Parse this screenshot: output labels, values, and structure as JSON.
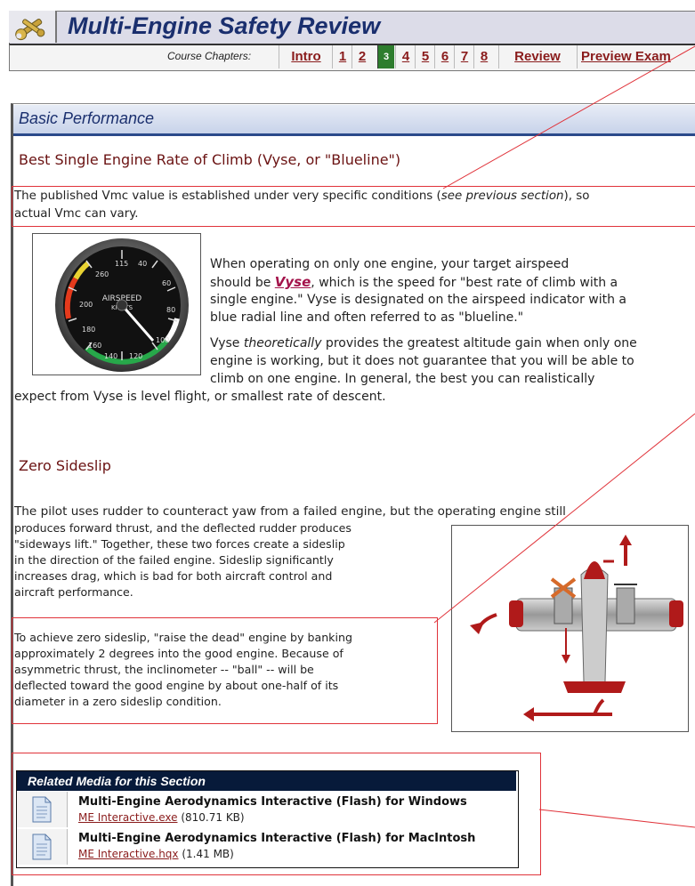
{
  "header": {
    "title": "Multi-Engine Safety Review",
    "nav_label": "Course Chapters:",
    "chapters": [
      "Intro",
      "1",
      "2",
      "3",
      "4",
      "5",
      "6",
      "7",
      "8",
      "Review",
      "Preview Exam"
    ],
    "active_chapter": "3"
  },
  "section": {
    "title": "Basic Performance"
  },
  "vyse": {
    "heading": "Best Single Engine Rate of Climb (Vyse, or \"Blueline\")",
    "intro_a": "The published Vmc value is established under very specific conditions (",
    "intro_see": "see previous section",
    "intro_b": "), so",
    "intro_c": "actual Vmc can vary.",
    "p1_l1": "When operating on only one engine, your target airspeed",
    "p1_l2a": "should be ",
    "p1_vyse": "Vyse",
    "p1_l2b": ", which is the speed for \"best rate of climb with a",
    "p1_l3": "single engine.\"  Vyse is designated on the airspeed indicator with a",
    "p1_l4": "blue radial line and often referred to as \"blueline.\"",
    "p2_l1a": "Vyse ",
    "p2_theor": "theoretically",
    "p2_l1b": " provides the greatest altitude gain when only one",
    "p2_l2": "engine is working, but it does not guarantee that you will be able to",
    "p2_l3": "climb on one engine.  In general, the best you can realistically",
    "p2_l4": "expect from Vyse is level flight, or smallest rate of descent."
  },
  "gauge": {
    "label1": "AIRSPEED",
    "label2": "KNOTS",
    "ticks": [
      "115",
      "260",
      "40",
      "60",
      "200",
      "80",
      "180",
      "160",
      "140",
      "120",
      "100"
    ]
  },
  "sideslip": {
    "heading": "Zero Sideslip",
    "p1_l1": "The pilot uses rudder to counteract yaw from a failed engine, but the operating engine still",
    "p1_l2": "produces forward thrust, and the deflected rudder produces",
    "p1_l3": "\"sideways lift.\"  Together, these two forces create a sideslip",
    "p1_l4": "in the direction of the failed engine.  Sideslip significantly",
    "p1_l5": "increases drag, which is bad for both aircraft control and",
    "p1_l6": "aircraft performance.",
    "p2_l1": "To achieve zero sideslip, \"raise the dead\" engine by banking",
    "p2_l2": "approximately 2 degrees into the good engine.  Because of",
    "p2_l3": "asymmetric thrust, the inclinometer -- \"ball\" -- will be",
    "p2_l4": "deflected toward the good engine by about one-half of its",
    "p2_l5": "diameter in a zero sideslip condition."
  },
  "related_media": {
    "heading": "Related Media for this Section",
    "items": [
      {
        "title": "Multi-Engine Aerodynamics Interactive (Flash) for Windows",
        "file": "ME Interactive.exe",
        "size": "(810.71 KB)"
      },
      {
        "title": "Multi-Engine Aerodynamics Interactive (Flash) for MacIntosh",
        "file": "ME Interactive.hqx",
        "size": "(1.41 MB)"
      }
    ]
  },
  "colors": {
    "title_blue": "#1a2f6e",
    "heading_red": "#6b1313",
    "link_red": "#8a1c1c",
    "active_green": "#2e7d2e",
    "highlight_red": "#e0333a"
  }
}
